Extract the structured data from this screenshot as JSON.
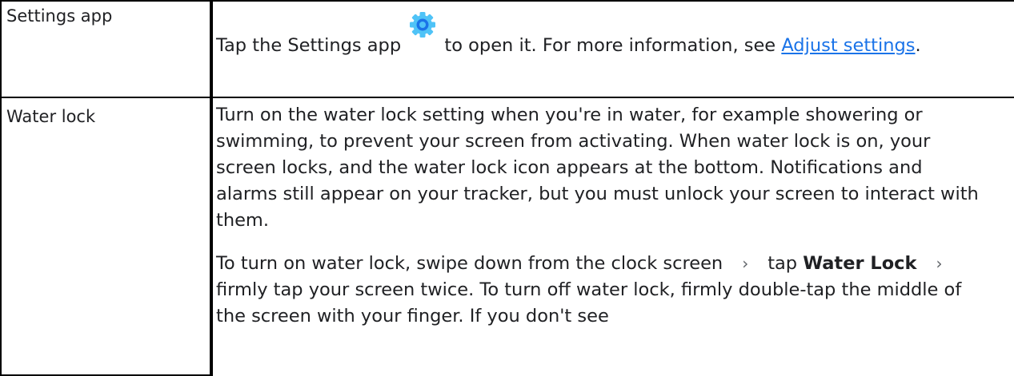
{
  "rows": [
    {
      "label": "Settings app",
      "body": {
        "text_before_icon": "Tap the Settings app",
        "icon": "settings-gear-icon",
        "text_after_icon": " to open it. For more information, see ",
        "link_text": "Adjust settings",
        "text_end": "."
      }
    },
    {
      "label": "Water lock",
      "paragraph_1": "Turn on the water lock setting when you're in water, for example showering or swimming, to prevent your screen from activating. When water lock is on, your screen locks, and the water lock icon appears at the bottom. Notifications and alarms still appear on your tracker, but you must unlock your screen to interact with them.",
      "paragraph_2": {
        "part_1": "To turn on water lock, swipe down from the clock screen",
        "part_2": "tap ",
        "bold_1": "Water Lock",
        "part_3": "firmly tap your screen twice. To turn off water lock, firmly double-tap the middle of the screen with your finger. If you don't see"
      },
      "separator_icon": "chevron-right-icon"
    }
  ],
  "colors": {
    "text": "#202124",
    "link": "#1a73e8",
    "gear_light": "#4fc3f7",
    "gear_dark": "#1a73e8",
    "border": "#000000"
  }
}
